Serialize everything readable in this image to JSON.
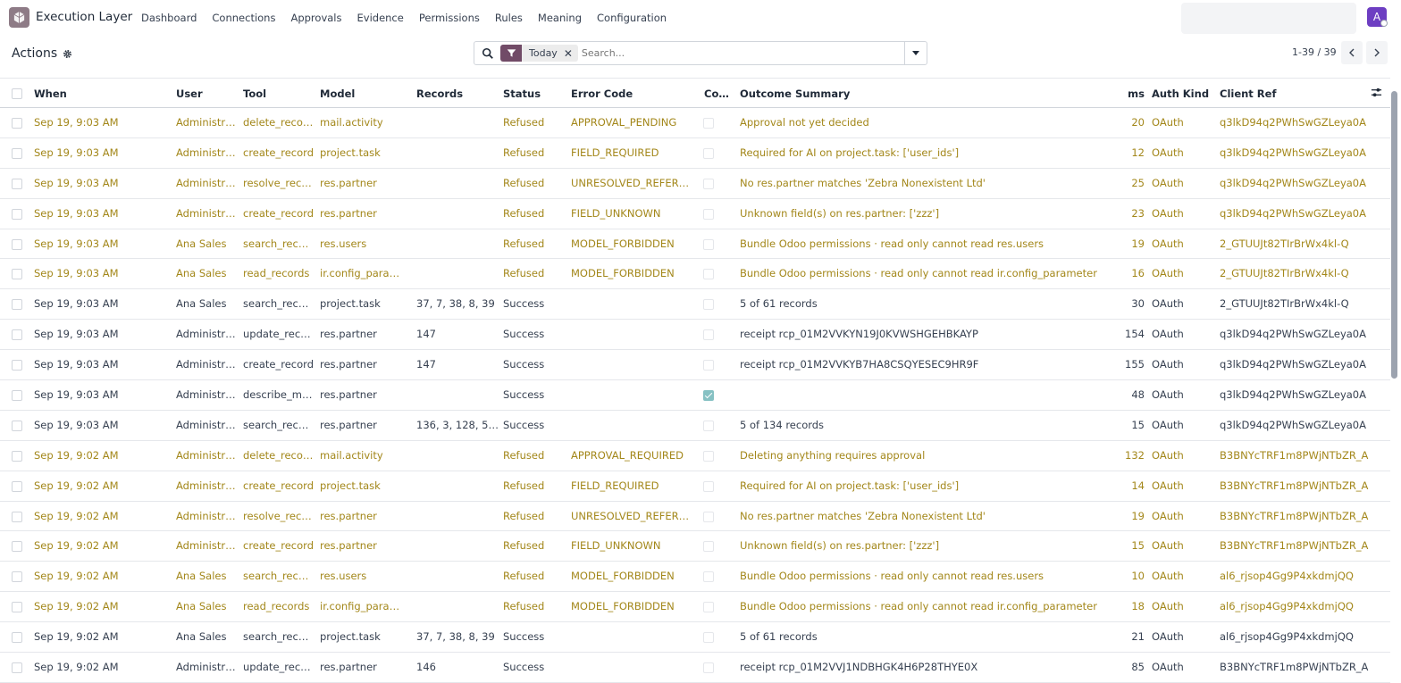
{
  "app": {
    "title": "Execution Layer",
    "avatar_letter": "A"
  },
  "nav": [
    "Dashboard",
    "Connections",
    "Approvals",
    "Evidence",
    "Permissions",
    "Rules",
    "Meaning",
    "Configuration"
  ],
  "control": {
    "breadcrumb": "Actions",
    "facet": "Today",
    "search_placeholder": "Search...",
    "pager": "1-39 / 39"
  },
  "columns": {
    "when": "When",
    "user": "User",
    "tool": "Tool",
    "model": "Model",
    "records": "Records",
    "status": "Status",
    "error_code": "Error Code",
    "conf": "Co…",
    "outcome": "Outcome Summary",
    "ms": "ms",
    "auth": "Auth Kind",
    "client": "Client Ref"
  },
  "colors": {
    "refused": "#a3871a",
    "brand": "#714b67",
    "avatar": "#6d3ec2"
  },
  "rows": [
    {
      "when": "Sep 19, 9:03 AM",
      "user": "Administr…",
      "tool": "delete_reco…",
      "model": "mail.activity",
      "records": "",
      "status": "Refused",
      "error": "APPROVAL_PENDING",
      "conf": false,
      "outcome": "Approval not yet decided",
      "ms": "20",
      "auth": "OAuth",
      "client": "q3lkD94q2PWhSwGZLeya0A"
    },
    {
      "when": "Sep 19, 9:03 AM",
      "user": "Administr…",
      "tool": "create_record",
      "model": "project.task",
      "records": "",
      "status": "Refused",
      "error": "FIELD_REQUIRED",
      "conf": false,
      "outcome": "Required for AI on project.task: ['user_ids']",
      "ms": "12",
      "auth": "OAuth",
      "client": "q3lkD94q2PWhSwGZLeya0A"
    },
    {
      "when": "Sep 19, 9:03 AM",
      "user": "Administr…",
      "tool": "resolve_rec…",
      "model": "res.partner",
      "records": "",
      "status": "Refused",
      "error": "UNRESOLVED_REFERE…",
      "conf": false,
      "outcome": "No res.partner matches 'Zebra Nonexistent Ltd'",
      "ms": "25",
      "auth": "OAuth",
      "client": "q3lkD94q2PWhSwGZLeya0A"
    },
    {
      "when": "Sep 19, 9:03 AM",
      "user": "Administr…",
      "tool": "create_record",
      "model": "res.partner",
      "records": "",
      "status": "Refused",
      "error": "FIELD_UNKNOWN",
      "conf": false,
      "outcome": "Unknown field(s) on res.partner: ['zzz']",
      "ms": "23",
      "auth": "OAuth",
      "client": "q3lkD94q2PWhSwGZLeya0A"
    },
    {
      "when": "Sep 19, 9:03 AM",
      "user": "Ana Sales",
      "tool": "search_reco…",
      "model": "res.users",
      "records": "",
      "status": "Refused",
      "error": "MODEL_FORBIDDEN",
      "conf": false,
      "outcome": "Bundle Odoo permissions · read only cannot read res.users",
      "ms": "19",
      "auth": "OAuth",
      "client": "2_GTUUJt82TIrBrWx4kl-Q"
    },
    {
      "when": "Sep 19, 9:03 AM",
      "user": "Ana Sales",
      "tool": "read_records",
      "model": "ir.config_param…",
      "records": "",
      "status": "Refused",
      "error": "MODEL_FORBIDDEN",
      "conf": false,
      "outcome": "Bundle Odoo permissions · read only cannot read ir.config_parameter",
      "ms": "16",
      "auth": "OAuth",
      "client": "2_GTUUJt82TIrBrWx4kl-Q"
    },
    {
      "when": "Sep 19, 9:03 AM",
      "user": "Ana Sales",
      "tool": "search_reco…",
      "model": "project.task",
      "records": "37, 7, 38, 8, 39",
      "status": "Success",
      "error": "",
      "conf": false,
      "outcome": "5 of 61 records",
      "ms": "30",
      "auth": "OAuth",
      "client": "2_GTUUJt82TIrBrWx4kl-Q"
    },
    {
      "when": "Sep 19, 9:03 AM",
      "user": "Administr…",
      "tool": "update_rec…",
      "model": "res.partner",
      "records": "147",
      "status": "Success",
      "error": "",
      "conf": false,
      "outcome": "receipt rcp_01M2VVKYN19J0KVWSHGEHBKAYP",
      "ms": "154",
      "auth": "OAuth",
      "client": "q3lkD94q2PWhSwGZLeya0A"
    },
    {
      "when": "Sep 19, 9:03 AM",
      "user": "Administr…",
      "tool": "create_record",
      "model": "res.partner",
      "records": "147",
      "status": "Success",
      "error": "",
      "conf": false,
      "outcome": "receipt rcp_01M2VVKYB7HA8CSQYESEC9HR9F",
      "ms": "155",
      "auth": "OAuth",
      "client": "q3lkD94q2PWhSwGZLeya0A"
    },
    {
      "when": "Sep 19, 9:03 AM",
      "user": "Administr…",
      "tool": "describe_m…",
      "model": "res.partner",
      "records": "",
      "status": "Success",
      "error": "",
      "conf": true,
      "outcome": "",
      "ms": "48",
      "auth": "OAuth",
      "client": "q3lkD94q2PWhSwGZLeya0A"
    },
    {
      "when": "Sep 19, 9:03 AM",
      "user": "Administr…",
      "tool": "search_reco…",
      "model": "res.partner",
      "records": "136, 3, 128, 58…",
      "status": "Success",
      "error": "",
      "conf": false,
      "outcome": "5 of 134 records",
      "ms": "15",
      "auth": "OAuth",
      "client": "q3lkD94q2PWhSwGZLeya0A"
    },
    {
      "when": "Sep 19, 9:02 AM",
      "user": "Administr…",
      "tool": "delete_reco…",
      "model": "mail.activity",
      "records": "",
      "status": "Refused",
      "error": "APPROVAL_REQUIRED",
      "conf": false,
      "outcome": "Deleting anything requires approval",
      "ms": "132",
      "auth": "OAuth",
      "client": "B3BNYcTRF1m8PWjNTbZR_A"
    },
    {
      "when": "Sep 19, 9:02 AM",
      "user": "Administr…",
      "tool": "create_record",
      "model": "project.task",
      "records": "",
      "status": "Refused",
      "error": "FIELD_REQUIRED",
      "conf": false,
      "outcome": "Required for AI on project.task: ['user_ids']",
      "ms": "14",
      "auth": "OAuth",
      "client": "B3BNYcTRF1m8PWjNTbZR_A"
    },
    {
      "when": "Sep 19, 9:02 AM",
      "user": "Administr…",
      "tool": "resolve_rec…",
      "model": "res.partner",
      "records": "",
      "status": "Refused",
      "error": "UNRESOLVED_REFERE…",
      "conf": false,
      "outcome": "No res.partner matches 'Zebra Nonexistent Ltd'",
      "ms": "19",
      "auth": "OAuth",
      "client": "B3BNYcTRF1m8PWjNTbZR_A"
    },
    {
      "when": "Sep 19, 9:02 AM",
      "user": "Administr…",
      "tool": "create_record",
      "model": "res.partner",
      "records": "",
      "status": "Refused",
      "error": "FIELD_UNKNOWN",
      "conf": false,
      "outcome": "Unknown field(s) on res.partner: ['zzz']",
      "ms": "15",
      "auth": "OAuth",
      "client": "B3BNYcTRF1m8PWjNTbZR_A"
    },
    {
      "when": "Sep 19, 9:02 AM",
      "user": "Ana Sales",
      "tool": "search_reco…",
      "model": "res.users",
      "records": "",
      "status": "Refused",
      "error": "MODEL_FORBIDDEN",
      "conf": false,
      "outcome": "Bundle Odoo permissions · read only cannot read res.users",
      "ms": "10",
      "auth": "OAuth",
      "client": "al6_rjsop4Gg9P4xkdmjQQ"
    },
    {
      "when": "Sep 19, 9:02 AM",
      "user": "Ana Sales",
      "tool": "read_records",
      "model": "ir.config_param…",
      "records": "",
      "status": "Refused",
      "error": "MODEL_FORBIDDEN",
      "conf": false,
      "outcome": "Bundle Odoo permissions · read only cannot read ir.config_parameter",
      "ms": "18",
      "auth": "OAuth",
      "client": "al6_rjsop4Gg9P4xkdmjQQ"
    },
    {
      "when": "Sep 19, 9:02 AM",
      "user": "Ana Sales",
      "tool": "search_reco…",
      "model": "project.task",
      "records": "37, 7, 38, 8, 39",
      "status": "Success",
      "error": "",
      "conf": false,
      "outcome": "5 of 61 records",
      "ms": "21",
      "auth": "OAuth",
      "client": "al6_rjsop4Gg9P4xkdmjQQ"
    },
    {
      "when": "Sep 19, 9:02 AM",
      "user": "Administr…",
      "tool": "update_rec…",
      "model": "res.partner",
      "records": "146",
      "status": "Success",
      "error": "",
      "conf": false,
      "outcome": "receipt rcp_01M2VVJ1NDBHGK4H6P28THYE0X",
      "ms": "85",
      "auth": "OAuth",
      "client": "B3BNYcTRF1m8PWjNTbZR_A"
    }
  ]
}
